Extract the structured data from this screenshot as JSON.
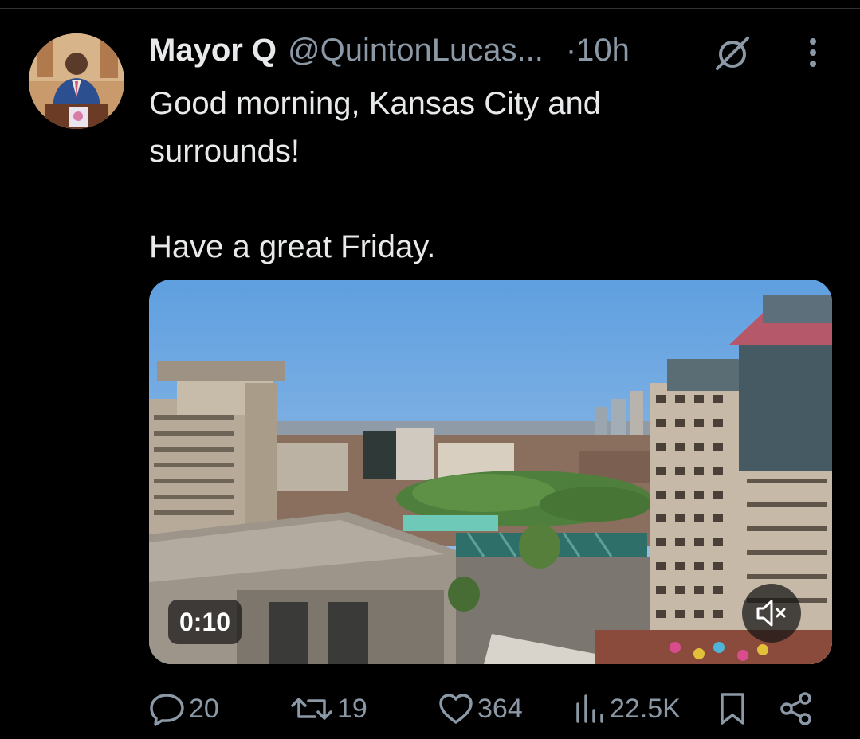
{
  "post": {
    "display_name": "Mayor Q",
    "handle": "@QuintonLucas...",
    "time": "·10h",
    "text": "Good morning, Kansas City and\nsurrounds!\n\nHave a great Friday.",
    "header_icons": [
      "hidden-post-icon",
      "more-options-icon"
    ]
  },
  "media": {
    "duration": "0:10",
    "mute_icon": "volume-muted-icon"
  },
  "actions": {
    "replies": "20",
    "reposts": "19",
    "likes": "364",
    "views": "22.5K",
    "bookmark_icon": "bookmark-icon",
    "share_icon": "share-icon"
  },
  "colors": {
    "background": "#000000",
    "primary_text": "#e7e9ea",
    "secondary_text": "#8b98a5"
  }
}
